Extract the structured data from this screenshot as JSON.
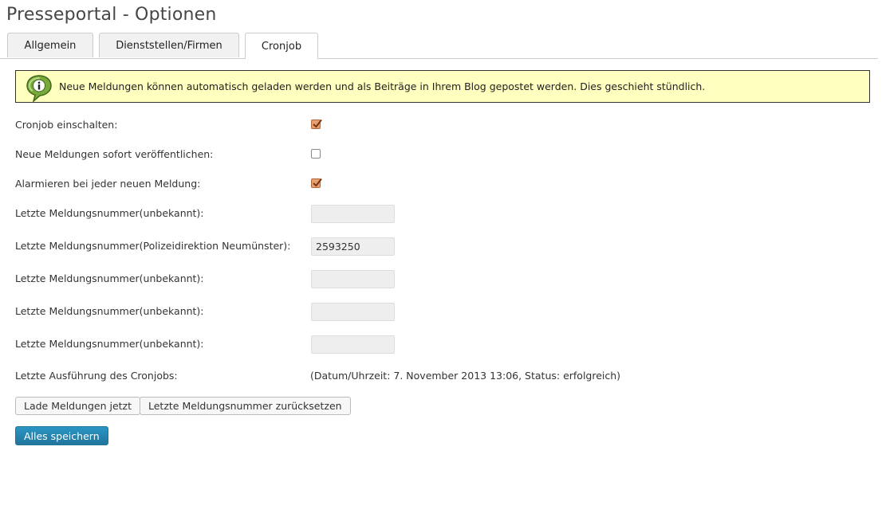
{
  "page": {
    "title": "Presseportal - Optionen"
  },
  "tabs": [
    {
      "label": "Allgemein"
    },
    {
      "label": "Dienststellen/Firmen"
    },
    {
      "label": "Cronjob"
    }
  ],
  "notice": {
    "icon": "info-bubble-icon",
    "text": "Neue Meldungen können automatisch geladen werden und als Beiträge in Ihrem Blog gepostet werden. Dies geschieht stündlich."
  },
  "settings": {
    "cron_enable": {
      "label": "Cronjob einschalten:",
      "checked": true
    },
    "publish_immediately": {
      "label": "Neue Meldungen sofort veröffentlichen:",
      "checked": false
    },
    "alert_each": {
      "label": "Alarmieren bei jeder neuen Meldung:",
      "checked": true
    },
    "numbers": [
      {
        "label": "Letzte Meldungsnummer(unbekannt):",
        "value": ""
      },
      {
        "label": "Letzte Meldungsnummer(Polizeidirektion Neumünster):",
        "value": "2593250"
      },
      {
        "label": "Letzte Meldungsnummer(unbekannt):",
        "value": ""
      },
      {
        "label": "Letzte Meldungsnummer(unbekannt):",
        "value": ""
      },
      {
        "label": "Letzte Meldungsnummer(unbekannt):",
        "value": ""
      }
    ],
    "last_run": {
      "label": "Letzte Ausführung des Cronjobs:",
      "value": "(Datum/Uhrzeit: 7. November 2013 13:06, Status: erfolgreich)"
    }
  },
  "buttons": {
    "load_now": "Lade Meldungen jetzt",
    "reset_numbers": "Letzte Meldungsnummer zurücksetzen",
    "save_all": "Alles speichern"
  },
  "colors": {
    "accent": "#21759b",
    "notice_bg": "#ffffc0",
    "checkbox_checked": "#e6a070"
  }
}
